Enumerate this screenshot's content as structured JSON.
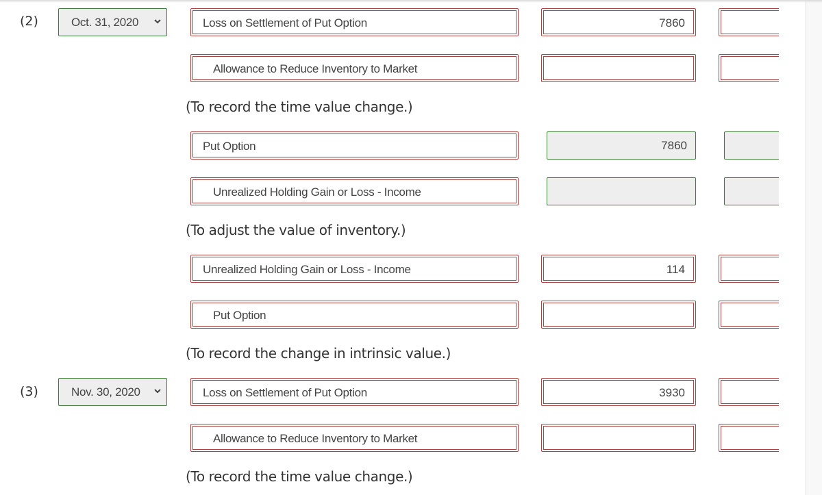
{
  "entries": [
    {
      "number": "(2)",
      "date": "Oct. 31, 2020",
      "groups": [
        {
          "lines": [
            {
              "account": "Loss on Settlement of Put Option",
              "debit": "7860",
              "credit": "",
              "status": "incorrect"
            },
            {
              "account": "Allowance to Reduce Inventory to Market",
              "debit": "",
              "credit": "",
              "status": "incorrect"
            }
          ],
          "memo": "(To record the time value change.)"
        },
        {
          "lines": [
            {
              "account": "Put Option",
              "debit": "7860",
              "credit": "",
              "status": "account-incorrect-amount-correct"
            },
            {
              "account": "Unrealized Holding Gain or Loss - Income",
              "debit": "",
              "credit": "",
              "status": "account-incorrect-amount-correct"
            }
          ],
          "memo": "(To adjust the value of inventory.)"
        },
        {
          "lines": [
            {
              "account": "Unrealized Holding Gain or Loss - Income",
              "debit": "114",
              "credit": "",
              "status": "incorrect"
            },
            {
              "account": "Put Option",
              "debit": "",
              "credit": "",
              "status": "incorrect"
            }
          ],
          "memo": "(To record the change in intrinsic value.)"
        }
      ]
    },
    {
      "number": "(3)",
      "date": "Nov. 30, 2020",
      "groups": [
        {
          "lines": [
            {
              "account": "Loss on Settlement of Put Option",
              "debit": "3930",
              "credit": "",
              "status": "incorrect"
            },
            {
              "account": "Allowance to Reduce Inventory to Market",
              "debit": "",
              "credit": "",
              "status": "incorrect"
            }
          ],
          "memo": "(To record the time value change.)"
        }
      ]
    }
  ],
  "colors": {
    "incorrect_border": "#a94442",
    "correct_border": "#3f7a3a",
    "readonly_bg": "#eeeeee"
  },
  "icons": {
    "dropdown": "chevron-down-icon"
  }
}
